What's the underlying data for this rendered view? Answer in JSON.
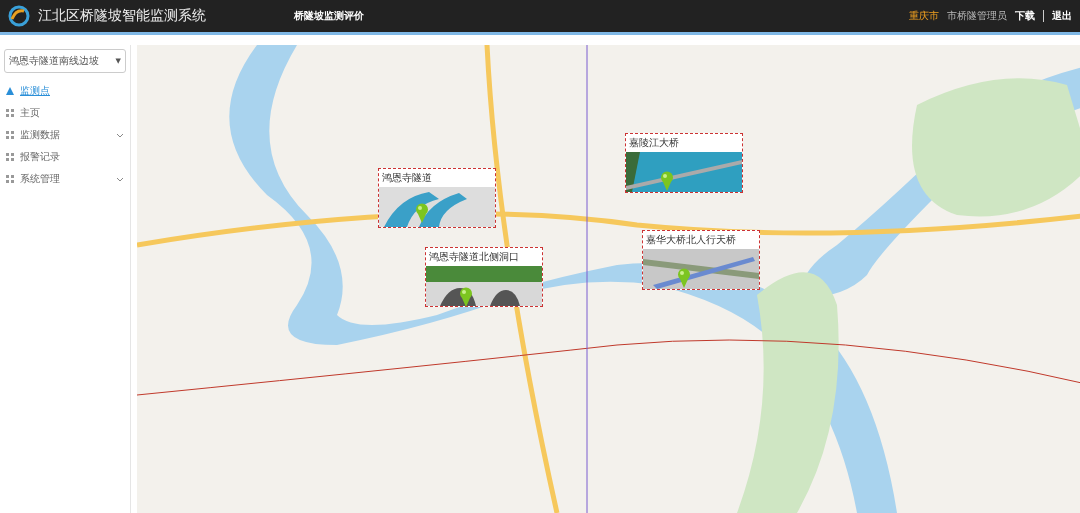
{
  "header": {
    "title": "江北区桥隧坡智能监测系统",
    "subtitle": "桥隧坡监测评价",
    "city": "重庆市",
    "user": "市桥隧管理员",
    "links": [
      {
        "label": "下载"
      },
      {
        "label": "退出"
      }
    ]
  },
  "sidebar": {
    "select": {
      "value": "鸿恩寺隧道南线边坡",
      "caret": "▼"
    },
    "items": [
      {
        "label": "监测点",
        "selected": true,
        "expandable": false
      },
      {
        "label": "主页",
        "selected": false,
        "expandable": false
      },
      {
        "label": "监测数据",
        "selected": false,
        "expandable": true
      },
      {
        "label": "报警记录",
        "selected": false,
        "expandable": false
      },
      {
        "label": "系统管理",
        "selected": false,
        "expandable": true
      }
    ]
  },
  "map": {
    "sites": [
      {
        "title": "鸿恩寺隧道",
        "kind": "tunnel"
      },
      {
        "title": "嘉陵江大桥",
        "kind": "bridge"
      },
      {
        "title": "鸿恩寺隧道北侧洞口",
        "kind": "portal"
      },
      {
        "title": "嘉华大桥北人行天桥",
        "kind": "footbridge"
      }
    ]
  }
}
